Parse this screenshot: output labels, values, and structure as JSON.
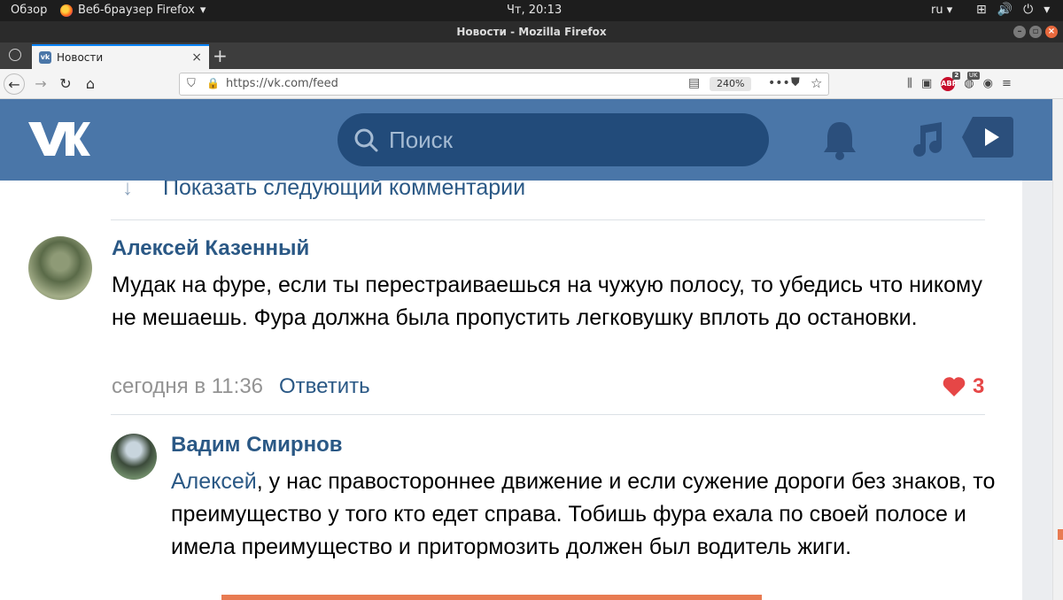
{
  "system_bar": {
    "overview": "Обзор",
    "app_name": "Веб-браузер Firefox",
    "clock": "Чт, 20:13",
    "lang": "ru"
  },
  "window": {
    "title": "Новости - Mozilla Firefox"
  },
  "tab": {
    "title": "Новости"
  },
  "navbar": {
    "url": "https://vk.com/feed",
    "zoom": "240%",
    "abp_badge": "2",
    "uk_badge": "UK"
  },
  "vk": {
    "search_placeholder": "Поиск",
    "show_more": "Показать следующий комментарии"
  },
  "comments": [
    {
      "author": "Алексей Казенный",
      "text": "Мудак на фуре, если ты перестраиваешься на чужую полосу, то убедись что никому не мешаешь. Фура должна была пропустить легковушку вплоть до остановки.",
      "time": "сегодня в 11:36",
      "reply": "Ответить",
      "likes": "3"
    },
    {
      "author": "Вадим Смирнов",
      "mention": "Алексей",
      "text": ", у нас правостороннее движение и если сужение дороги без знаков, то преимущество у того кто едет справа. Тобишь фура ехала по своей полосе и имела преимущество и притормозить должен был водитель жиги."
    }
  ],
  "colors": {
    "vk_blue": "#4a76a8",
    "vk_link": "#2a5885",
    "like_red": "#e64646"
  }
}
